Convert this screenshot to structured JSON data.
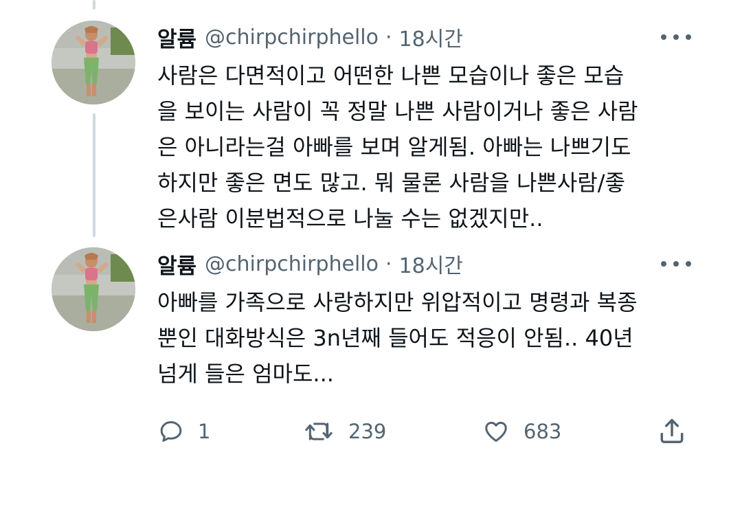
{
  "tweets": [
    {
      "display_name": "알륨",
      "handle": "@chirpchirphello",
      "separator": "·",
      "time": "18시간",
      "lines": [
        "사람은 다면적이고 어떤한 나쁜 모습이나 좋은 모습",
        "을 보이는 사람이 꼭 정말 나쁜 사람이거나 좋은 사람",
        "은 아니라는걸 아빠를 보며 알게됨. 아빠는 나쁘기도",
        "하지만 좋은 면도 많고. 뭐 물론 사람을 나쁜사람/좋",
        "은사람 이분법적으로 나눌 수는 없겠지만.."
      ]
    },
    {
      "display_name": "알륨",
      "handle": "@chirpchirphello",
      "separator": "·",
      "time": "18시간",
      "lines": [
        "아빠를 가족으로 사랑하지만 위압적이고 명령과 복종",
        "뿐인 대화방식은 3n년째 들어도 적응이 안됨.. 40년",
        "넘게 들은 엄마도..."
      ]
    }
  ],
  "actions": {
    "reply_count": "1",
    "retweet_count": "239",
    "like_count": "683"
  },
  "icons": {
    "reply": "reply-icon",
    "retweet": "retweet-icon",
    "like": "heart-icon",
    "share": "share-icon",
    "more": "more-icon"
  },
  "colors": {
    "text": "#0f1419",
    "secondary": "#536471",
    "thread_line": "#cfd9de",
    "background": "#ffffff"
  }
}
